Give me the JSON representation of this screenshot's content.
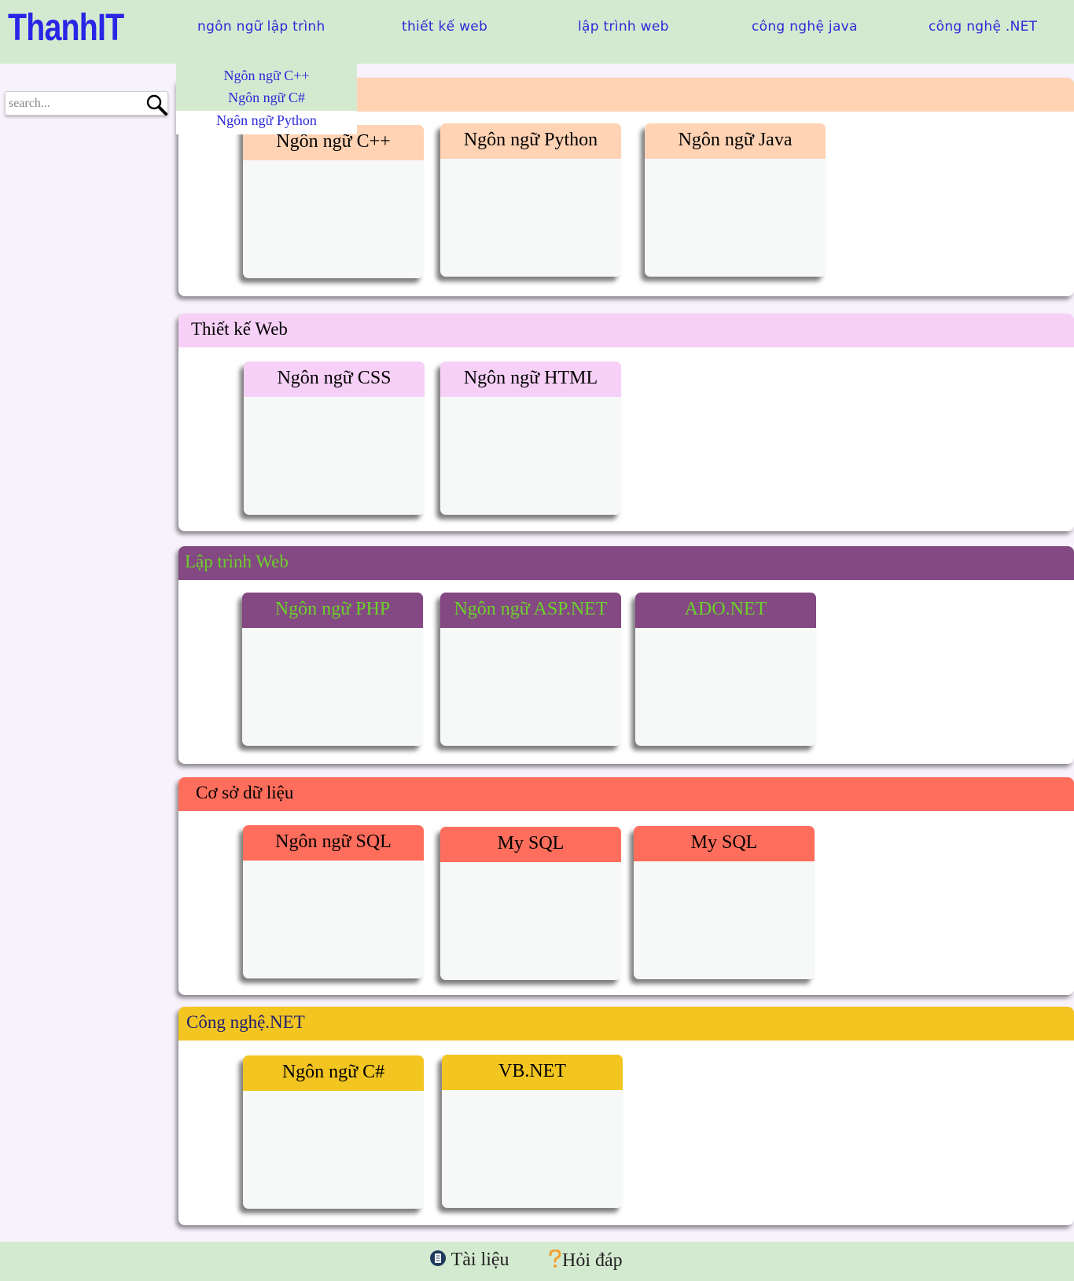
{
  "header": {
    "logo": "ThanhIT",
    "nav": [
      {
        "label": "ngôn ngữ lập trình"
      },
      {
        "label": "thiết kế web"
      },
      {
        "label": "lập trình web"
      },
      {
        "label": "công nghệ java"
      },
      {
        "label": "công nghệ .NET"
      }
    ]
  },
  "dropdown": {
    "items": [
      {
        "label": "Ngôn ngữ C++"
      },
      {
        "label": "Ngôn ngữ C#"
      },
      {
        "label": "Ngôn ngữ Python"
      }
    ]
  },
  "search": {
    "placeholder": "search...",
    "icon": "search-icon"
  },
  "sections": [
    {
      "title": "",
      "header_color": "#ffd3b4",
      "title_color": "#000000",
      "cards": [
        {
          "title": "Ngôn ngữ C++"
        },
        {
          "title": "Ngôn ngữ Python"
        },
        {
          "title": "Ngôn ngữ Java"
        }
      ]
    },
    {
      "title": "Thiết kế Web",
      "header_color": "#f7d0f7",
      "title_color": "#000000",
      "cards": [
        {
          "title": "Ngôn ngữ CSS"
        },
        {
          "title": "Ngôn ngữ HTML"
        }
      ]
    },
    {
      "title": "Lập trình Web",
      "header_color": "#844882",
      "title_color": "#6bd02a",
      "cards": [
        {
          "title": "Ngôn ngữ PHP"
        },
        {
          "title": "Ngôn ngữ ASP.NET"
        },
        {
          "title": "ADO.NET"
        }
      ]
    },
    {
      "title": "Cơ sở dữ liệu",
      "header_color": "#ff6e5c",
      "title_color": "#000000",
      "cards": [
        {
          "title": "Ngôn ngữ SQL"
        },
        {
          "title": "My SQL"
        },
        {
          "title": "My SQL"
        }
      ]
    },
    {
      "title": "Công nghệ.NET",
      "header_color": "#f2c521",
      "title_color": "#1e1e6e",
      "cards": [
        {
          "title": "Ngôn ngữ C#"
        },
        {
          "title": "VB.NET"
        }
      ]
    }
  ],
  "footer": {
    "docs": {
      "label": "Tài liệu",
      "icon": "document-icon"
    },
    "faq": {
      "label": "Hỏi đáp",
      "icon": "question-icon"
    }
  }
}
